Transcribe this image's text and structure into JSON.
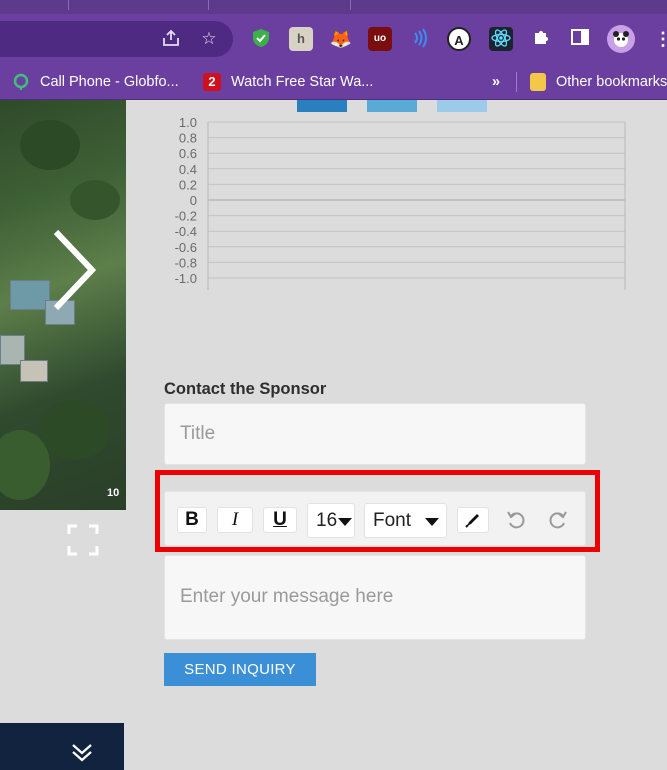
{
  "browser": {
    "bookmarks": [
      {
        "label": "Call Phone - Globfo...",
        "favicon": "globfone-icon"
      },
      {
        "label": "Watch Free Star Wa...",
        "favicon": "channel-2-icon"
      }
    ],
    "overflow_label": "»",
    "other_bookmarks": "Other bookmarks",
    "extensions": [
      "shield-check-icon",
      "h-extension-icon",
      "metamask-fox-icon",
      "ublock-origin-icon",
      "wifi-signal-icon",
      "a-circle-icon",
      "react-devtools-icon",
      "puzzle-icon",
      "side-panel-icon",
      "profile-avatar-icon",
      "menu-dots-icon"
    ]
  },
  "gallery": {
    "counter": "10"
  },
  "chart_data": {
    "type": "bar",
    "categories": [],
    "series": [
      {
        "values": [],
        "color": "#2a80bf"
      },
      {
        "values": [],
        "color": "#5aaad8"
      },
      {
        "values": [],
        "color": "#9bcbe8"
      }
    ],
    "yticks": [
      "1.0",
      "0.8",
      "0.6",
      "0.4",
      "0.2",
      "0",
      "-0.2",
      "-0.4",
      "-0.6",
      "-0.8",
      "-1.0"
    ],
    "ylim": [
      -1.0,
      1.0
    ],
    "grid": true
  },
  "contact": {
    "heading": "Contact the Sponsor",
    "title_placeholder": "Title",
    "message_placeholder": "Enter your message here",
    "toolbar": {
      "bold": "B",
      "italic": "I",
      "underline": "U",
      "font_size": "16",
      "font_family": "Font"
    },
    "send_label": "SEND INQUIRY"
  }
}
